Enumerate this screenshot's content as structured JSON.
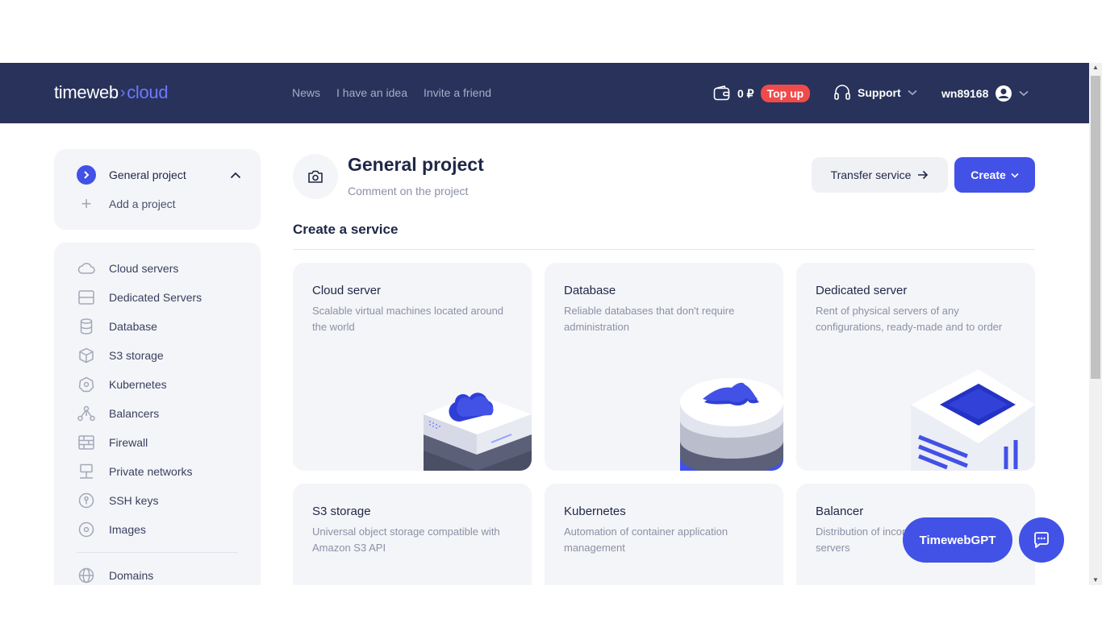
{
  "header": {
    "logo_left": "timeweb",
    "logo_right": "cloud",
    "nav": [
      "News",
      "I have an idea",
      "Invite a friend"
    ],
    "balance": "0 ₽",
    "topup_label": "Top up",
    "support_label": "Support",
    "username": "wn89168"
  },
  "sidebar": {
    "project_name": "General project",
    "add_project_label": "Add a project",
    "services": [
      {
        "label": "Cloud servers",
        "icon": "cloud-icon"
      },
      {
        "label": "Dedicated Servers",
        "icon": "server-icon"
      },
      {
        "label": "Database",
        "icon": "database-icon"
      },
      {
        "label": "S3 storage",
        "icon": "cube-icon"
      },
      {
        "label": "Kubernetes",
        "icon": "kubernetes-icon"
      },
      {
        "label": "Balancers",
        "icon": "balancer-icon"
      },
      {
        "label": "Firewall",
        "icon": "firewall-icon"
      },
      {
        "label": "Private networks",
        "icon": "network-icon"
      },
      {
        "label": "SSH keys",
        "icon": "key-icon"
      },
      {
        "label": "Images",
        "icon": "disk-icon"
      }
    ],
    "domains_label": "Domains"
  },
  "main": {
    "title": "General project",
    "comment": "Comment on the project",
    "transfer_label": "Transfer service",
    "create_label": "Create",
    "section_title": "Create a service",
    "cards": [
      {
        "title": "Cloud server",
        "desc": "Scalable virtual machines located around the world"
      },
      {
        "title": "Database",
        "desc": "Reliable databases that don't require administration"
      },
      {
        "title": "Dedicated server",
        "desc": "Rent of physical servers of any configurations, ready-made and to order"
      },
      {
        "title": "S3 storage",
        "desc": "Universal object storage compatible with Amazon S3 API"
      },
      {
        "title": "Kubernetes",
        "desc": "Automation of container application management"
      },
      {
        "title": "Balancer",
        "desc": "Distribution of incoming traffic between servers"
      }
    ]
  },
  "floating": {
    "gpt_label": "TimewebGPT"
  },
  "colors": {
    "header_bg": "#28325b",
    "accent": "#4251e6",
    "topup": "#f04a4a"
  }
}
